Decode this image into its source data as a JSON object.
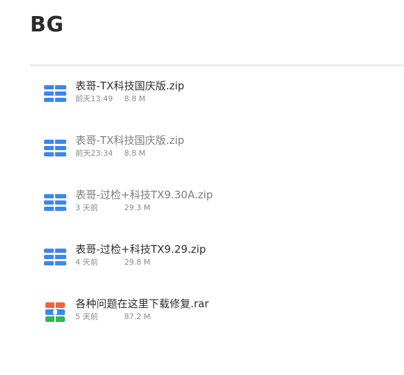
{
  "header": {
    "title": "BG"
  },
  "files": [
    {
      "name": "表哥-TX科技国庆版.zip",
      "time": "前天13:49",
      "size": "8.8 M",
      "icon": "zip-archive-icon",
      "name_color": "#2e2e2e"
    },
    {
      "name": "表哥-TX科技国庆版.zip",
      "time": "前天23:34",
      "size": "8.8 M",
      "icon": "zip-archive-icon",
      "name_color": "#7d7d7d"
    },
    {
      "name": "表哥-过检+科技TX9.30A.zip",
      "time": "3 天前",
      "size": "29.3 M",
      "icon": "zip-archive-icon",
      "name_color": "#7d7d7d"
    },
    {
      "name": "表哥-过检+科技TX9.29.zip",
      "time": "4 天前",
      "size": "29.8 M",
      "icon": "zip-archive-icon",
      "name_color": "#2e2e2e"
    },
    {
      "name": "各种问题在这里下载修复.rar",
      "time": "5 天前",
      "size": "87.2 M",
      "icon": "rar-archive-icon",
      "name_color": "#2e2e2e"
    }
  ],
  "colors": {
    "zip_icon_blue": "#3b86f0",
    "rar_icon_orange": "#f0653a",
    "rar_icon_blue": "#3b86f0",
    "rar_icon_green": "#2fb84a",
    "meta_gray": "#8a8a8a",
    "divider": "#ececec"
  }
}
